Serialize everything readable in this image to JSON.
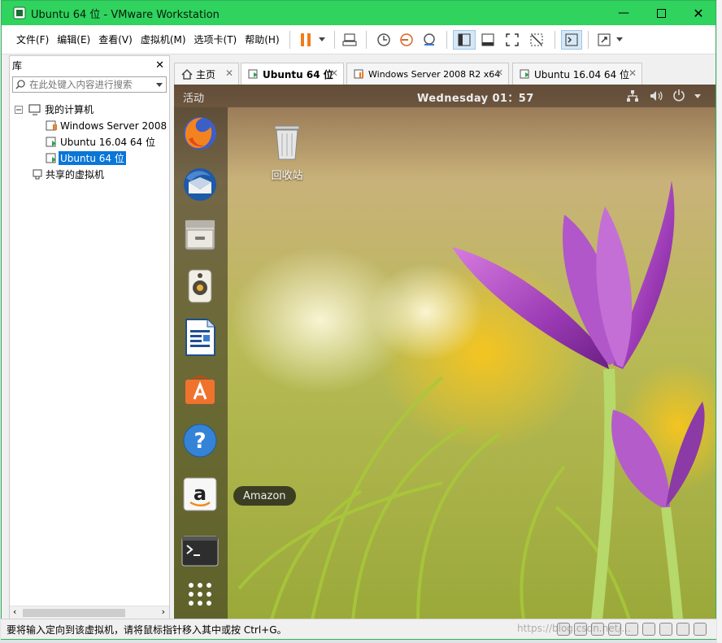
{
  "window": {
    "title": "Ubuntu 64 位 - VMware Workstation"
  },
  "menu": [
    "文件(F)",
    "编辑(E)",
    "查看(V)",
    "虚拟机(M)",
    "选项卡(T)",
    "帮助(H)"
  ],
  "library": {
    "title": "库",
    "search_placeholder": "在此处键入内容进行搜索",
    "tree": [
      {
        "label": "我的计算机",
        "icon": "computer-icon"
      },
      {
        "label": "Windows Server 2008",
        "icon": "vm-icon"
      },
      {
        "label": "Ubuntu 16.04 64 位",
        "icon": "vm-icon"
      },
      {
        "label": "Ubuntu 64 位",
        "icon": "vm-running-icon",
        "selected": true
      },
      {
        "label": "共享的虚拟机",
        "icon": "shared-vm-icon"
      }
    ]
  },
  "tabs": [
    {
      "label": "主页",
      "icon": "home-icon"
    },
    {
      "label": "Ubuntu 64 位",
      "active": true
    },
    {
      "label": "Windows Server 2008 R2 x64"
    },
    {
      "label": "Ubuntu 16.04 64 位"
    }
  ],
  "guest": {
    "activities": "活动",
    "clock": "Wednesday 01：57",
    "trash_label": "回收站",
    "tooltip": "Amazon",
    "dock": [
      "firefox-icon",
      "thunderbird-icon",
      "files-icon",
      "rhythmbox-icon",
      "writer-icon",
      "software-center-icon",
      "help-icon",
      "amazon-icon",
      "terminal-icon",
      "app-grid-icon"
    ]
  },
  "status": {
    "message": "要将输入定向到该虚拟机，请将鼠标指针移入其中或按 Ctrl+G。"
  },
  "watermark": "https://blog.csdn.net/...",
  "colors": {
    "titlebar": "#2fd35e",
    "selection": "#0a76d8",
    "pause": "#f07c1a"
  }
}
